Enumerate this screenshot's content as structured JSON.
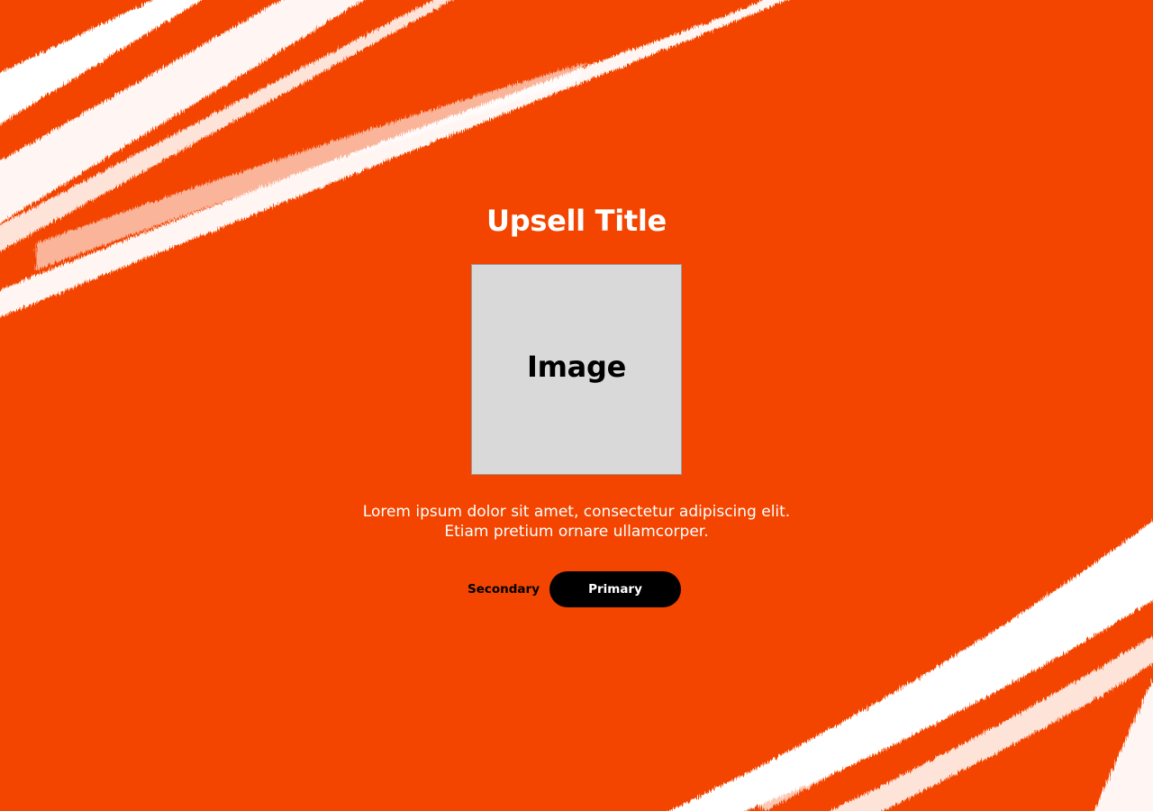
{
  "colors": {
    "background": "#f34500",
    "brush_stroke": "#ffffff",
    "title_text": "#ffffff",
    "body_text": "#ffffff",
    "image_placeholder_fill": "#d9d9d9",
    "image_placeholder_border": "#9a9a9a",
    "primary_button_fill": "#000000",
    "primary_button_text": "#ffffff",
    "secondary_button_text": "#000000"
  },
  "upsell": {
    "title": "Upsell Title",
    "image_label": "Image",
    "body_lines": [
      "Lorem ipsum dolor sit amet, consectetur adipiscing elit.",
      "Etiam pretium ornare ullamcorper."
    ],
    "secondary_label": "Secondary",
    "primary_label": "Primary"
  }
}
